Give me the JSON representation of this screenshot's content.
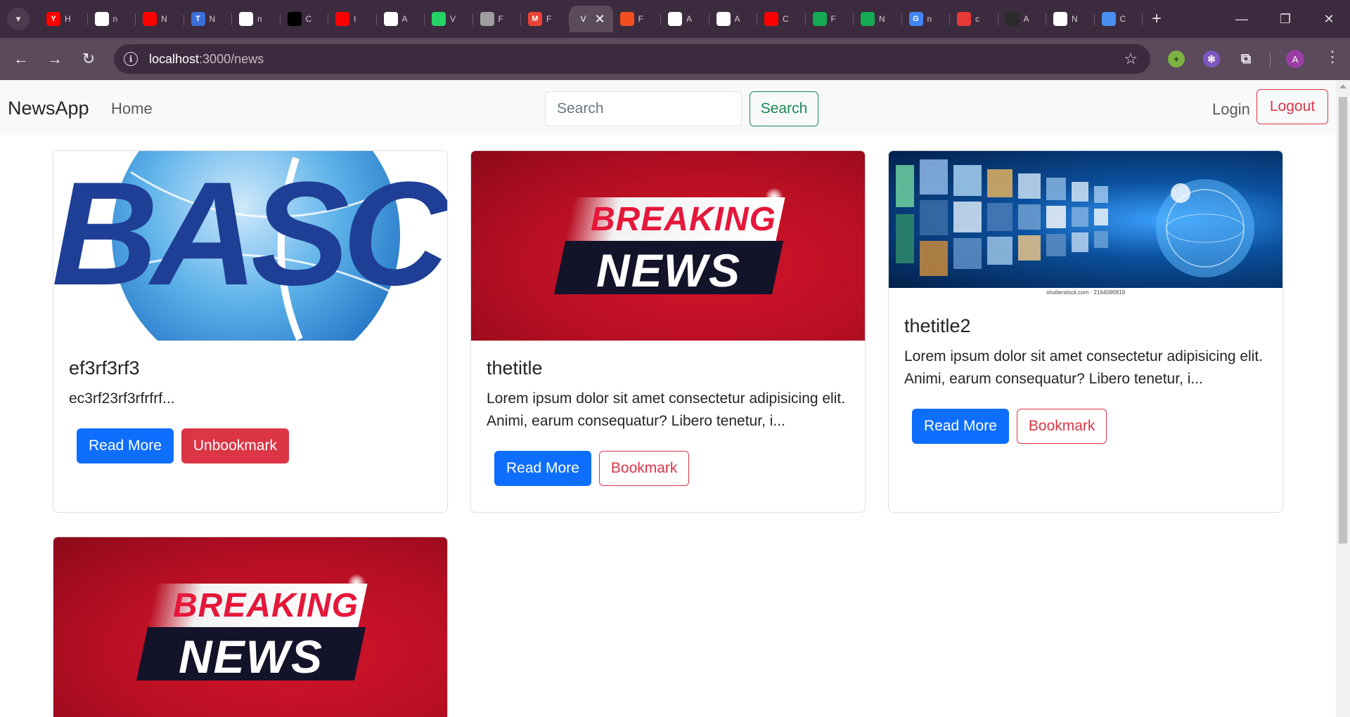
{
  "browser": {
    "tabs": [
      {
        "icon": "youtube-icon",
        "label": "Y",
        "color": "#ff0000",
        "title": "H"
      },
      {
        "icon": "github-icon",
        "label": "",
        "color": "#ffffff",
        "title": "n"
      },
      {
        "icon": "youtube-icon",
        "label": "",
        "color": "#ff0000",
        "title": "N"
      },
      {
        "icon": "t-icon",
        "label": "T",
        "color": "#3b6fd8",
        "title": "N"
      },
      {
        "icon": "github-icon",
        "label": "",
        "color": "#ffffff",
        "title": "n"
      },
      {
        "icon": "medium-icon",
        "label": "",
        "color": "#000000",
        "title": "C"
      },
      {
        "icon": "youtube-icon",
        "label": "",
        "color": "#ff0000",
        "title": "I"
      },
      {
        "icon": "chatgpt-icon",
        "label": "",
        "color": "#ffffff",
        "title": "A"
      },
      {
        "icon": "whatsapp-icon",
        "label": "",
        "color": "#25d366",
        "title": "V"
      },
      {
        "icon": "globe-icon",
        "label": "",
        "color": "#9e9e9e",
        "title": "F"
      },
      {
        "icon": "gmail-icon",
        "label": "M",
        "color": "#ea4335",
        "title": "F"
      },
      {
        "icon": "active-tab",
        "label": "",
        "color": "#5a4a5c",
        "title": "V",
        "active": true
      },
      {
        "icon": "figma-icon",
        "label": "",
        "color": "#f24e1e",
        "title": "F"
      },
      {
        "icon": "github-icon",
        "label": "",
        "color": "#ffffff",
        "title": "A"
      },
      {
        "icon": "github-icon",
        "label": "",
        "color": "#ffffff",
        "title": "A"
      },
      {
        "icon": "youtube-icon",
        "label": "",
        "color": "#ff0000",
        "title": "C"
      },
      {
        "icon": "mongodb-icon",
        "label": "",
        "color": "#13aa52",
        "title": "F"
      },
      {
        "icon": "mongodb-icon",
        "label": "",
        "color": "#13aa52",
        "title": "N"
      },
      {
        "icon": "google-icon",
        "label": "G",
        "color": "#4285f4",
        "title": "n"
      },
      {
        "icon": "red-app-icon",
        "label": "",
        "color": "#e53935",
        "title": "c"
      },
      {
        "icon": "github-icon",
        "label": "",
        "color": "#2b2b2b",
        "title": "A"
      },
      {
        "icon": "chrome-icon",
        "label": "",
        "color": "#ffffff",
        "title": "N"
      },
      {
        "icon": "gemini-icon",
        "label": "",
        "color": "#4a8ef0",
        "title": "C"
      }
    ],
    "url_host": "localhost",
    "url_path": ":3000/news",
    "avatar_letter": "A"
  },
  "navbar": {
    "brand": "NewsApp",
    "home": "Home",
    "search_placeholder": "Search",
    "search_button": "Search",
    "login": "Login",
    "logout": "Logout"
  },
  "cards": [
    {
      "image": "basc-logo",
      "title": "ef3rf3rf3",
      "text": "ec3rf23rf3rfrfrf...",
      "read_more": "Read More",
      "bookmark": "Unbookmark",
      "bookmarked": true
    },
    {
      "image": "breaking-news",
      "title": "thetitle",
      "text": "Lorem ipsum dolor sit amet consectetur adipisicing elit. Animi, earum consequatur? Libero tenetur, i...",
      "read_more": "Read More",
      "bookmark": "Bookmark",
      "bookmarked": false
    },
    {
      "image": "media-wall",
      "title": "thetitle2",
      "text": "Lorem ipsum dolor sit amet consectetur adipisicing elit. Animi, earum consequatur? Libero tenetur, i...",
      "read_more": "Read More",
      "bookmark": "Bookmark",
      "bookmarked": false
    },
    {
      "image": "breaking-news"
    }
  ],
  "images": {
    "basc_logo_text": "BASC",
    "breaking_line1": "BREAKING",
    "breaking_line2": "NEWS",
    "media_wall_credit": "shutterstock.com · 2164090919"
  }
}
